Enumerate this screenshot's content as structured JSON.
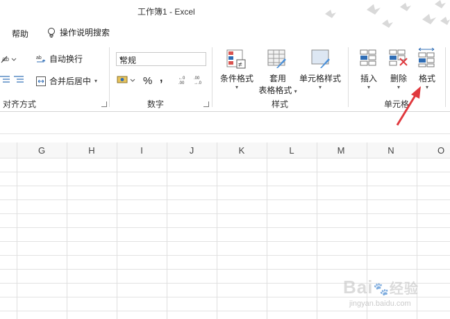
{
  "window": {
    "title": "工作簿1  -  Excel"
  },
  "menubar": {
    "help": "帮助",
    "search": "操作说明搜索"
  },
  "ribbon": {
    "alignment": {
      "wrap_text": "自动换行",
      "merge_center": "合并后居中",
      "label": "对齐方式"
    },
    "number": {
      "format_value": "常规",
      "percent": "%",
      "comma": ",",
      "label": "数字"
    },
    "styles": {
      "conditional": "条件格式",
      "table_line1": "套用",
      "table_line2": "表格格式",
      "cell_styles": "单元格样式",
      "label": "样式"
    },
    "cells": {
      "insert": "插入",
      "delete": "删除",
      "format": "格式",
      "label": "单元格"
    }
  },
  "columns": [
    "G",
    "H",
    "I",
    "J",
    "K",
    "L",
    "M",
    "N",
    "O"
  ],
  "watermark": {
    "brand": "Bai",
    "brand2": "经验",
    "url": "jingyan.baidu.com"
  },
  "colors": {
    "accent_red": "#e0393e",
    "grid": "#e2e2e2"
  }
}
